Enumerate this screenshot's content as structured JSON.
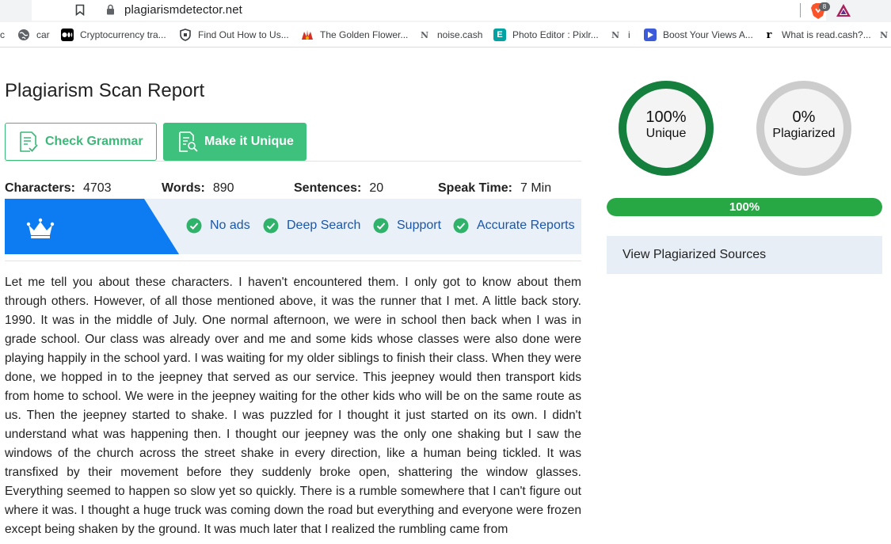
{
  "browser": {
    "url": "plagiarismdetector.net",
    "extension_badge": "8",
    "bookmarks": [
      {
        "label": "c",
        "icon": "truncated-bookmark",
        "color": "#3c4043"
      },
      {
        "label": "car",
        "icon": "globe-icon",
        "color": "#5f6368"
      },
      {
        "label": "Cryptocurrency tra...",
        "icon": "medium-icon",
        "color": "#000000"
      },
      {
        "label": "Find Out How to Us...",
        "icon": "shield-icon",
        "color": "#3c4043"
      },
      {
        "label": "The Golden Flower...",
        "icon": "flower-icon",
        "color": "#d93025"
      },
      {
        "label": "noise.cash",
        "icon": "noise-cash-icon",
        "color": "#5f6368"
      },
      {
        "label": "Photo Editor : Pixlr...",
        "icon": "pixlr-icon",
        "color": "#00a3a3"
      },
      {
        "label": "i",
        "icon": "noise-cash-icon",
        "color": "#5f6368"
      },
      {
        "label": "Boost Your Views A...",
        "icon": "play-icon",
        "color": "#3b5bdb"
      },
      {
        "label": "What is read.cash?...",
        "icon": "read-cash-icon",
        "color": "#000000"
      }
    ]
  },
  "report": {
    "title": "Plagiarism Scan Report",
    "check_grammar_label": "Check Grammar",
    "make_unique_label": "Make it Unique",
    "stats": {
      "characters_label": "Characters:",
      "characters_value": "4703",
      "words_label": "Words:",
      "words_value": "890",
      "sentences_label": "Sentences:",
      "sentences_value": "20",
      "speak_time_label": "Speak Time:",
      "speak_time_value": "7 Min"
    },
    "features": [
      "No ads",
      "Deep Search",
      "Support",
      "Accurate Reports"
    ],
    "text": "Let me tell you about these characters. I haven't encountered them. I only got to know about them through others. However, of all those mentioned above, it was the runner that I met. A little back story. 1990. It was in the middle of July. One normal afternoon, we were in school then back when I was in grade school. Our class was already over and me and some kids whose classes were also done were playing happily in the school yard. I was waiting for my older siblings to finish their class. When they were done, we hopped in to the jeepney that served as our service. This jeepney would then transport kids from home to school. We were in the jeepney waiting for the other kids who will be on the same route as us. Then the jeepney started to shake. I was puzzled for I thought it just started on its own. I didn't understand what was happening then. I thought our jeepney was the only one shaking but I saw the windows of the church across the street shake in every direction, like a human being tickled. It was transfixed by their movement before they suddenly broke open, shattering the window glasses. Everything seemed to happen so slow yet so quickly. There is a rumble somewhere that I can't figure out where it was. I thought a huge truck was coming down the road but everything and everyone were frozen except being shaken by the ground. It was much later that I realized the rumbling came from"
  },
  "results": {
    "unique_value": "100%",
    "unique_label": "Unique",
    "unique_fraction": 1.0,
    "plagiarized_value": "0%",
    "plagiarized_label": "Plagiarized",
    "plagiarized_fraction": 0.0,
    "progress_text": "100%",
    "progress_fraction": 1.0,
    "view_sources_label": "View Plagiarized Sources"
  },
  "colors": {
    "unique_ring": "#15803d",
    "plagiarized_ring": "#cccccc",
    "progress": "#28a745",
    "accent_green": "#3ec17d",
    "promo_blue": "#0d7bf2"
  }
}
